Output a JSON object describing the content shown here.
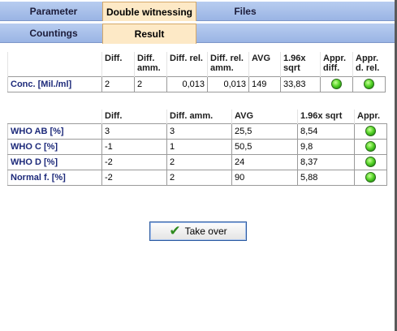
{
  "tabs_top": [
    {
      "label": "Parameter",
      "active": false
    },
    {
      "label": "Double witnessing",
      "active": true
    },
    {
      "label": "Files",
      "active": false
    }
  ],
  "tabs_sub": [
    {
      "label": "Countings",
      "active": false
    },
    {
      "label": "Result",
      "active": true
    }
  ],
  "conc_table": {
    "headers": [
      "Diff.",
      "Diff. amm.",
      "Diff. rel.",
      "Diff. rel. amm.",
      "AVG",
      "1.96x sqrt",
      "Appr. diff.",
      "Appr. d. rel."
    ],
    "row": {
      "label": "Conc. [Mil./ml]",
      "values": [
        "2",
        "2",
        "0,013",
        "0,013",
        "149",
        "33,83"
      ],
      "appr_diff": "green-led-icon",
      "appr_d_rel": "green-led-icon"
    }
  },
  "who_table": {
    "headers": [
      "Diff.",
      "Diff. amm.",
      "AVG",
      "1.96x sqrt",
      "Appr."
    ],
    "rows": [
      {
        "label": "WHO AB [%]",
        "values": [
          "3",
          "3",
          "25,5",
          "8,54"
        ],
        "appr": "green-led-icon"
      },
      {
        "label": "WHO C [%]",
        "values": [
          "-1",
          "1",
          "50,5",
          "9,8"
        ],
        "appr": "green-led-icon"
      },
      {
        "label": "WHO D [%]",
        "values": [
          "-2",
          "2",
          "24",
          "8,37"
        ],
        "appr": "green-led-icon"
      },
      {
        "label": "Normal f. [%]",
        "values": [
          "-2",
          "2",
          "90",
          "5,88"
        ],
        "appr": "green-led-icon"
      }
    ]
  },
  "take_over": {
    "label": "Take over",
    "icon": "checkmark-icon"
  }
}
